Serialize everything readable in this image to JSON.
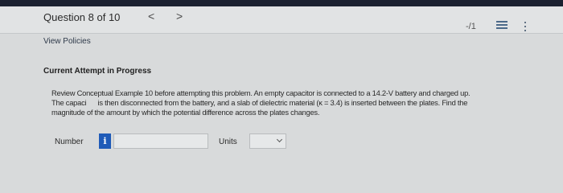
{
  "header": {
    "question_title": "Question 8 of 10",
    "prev_glyph": "<",
    "next_glyph": ">",
    "score": "-/1",
    "list_icon": "list-icon",
    "more_icon": "more-vertical-icon"
  },
  "links": {
    "view_policies": "View Policies"
  },
  "attempt": {
    "status": "Current Attempt in Progress"
  },
  "question": {
    "text_line1": "Review Conceptual Example 10 before attempting this problem. An empty capacitor is connected to a 14.2-V battery and charged up.",
    "text_line2": "The capaci      is then disconnected from the battery, and a slab of dielectric material (κ = 3.4) is inserted between the plates. Find the",
    "text_line3": "magnitude of the amount by which the potential difference across the plates changes."
  },
  "answer": {
    "number_label": "Number",
    "info_glyph": "i",
    "number_value": "",
    "units_label": "Units",
    "units_selected": ""
  },
  "colors": {
    "top_bar": "#1b2130",
    "info_badge": "#1f5bb8",
    "page_background": "#d8dadb"
  }
}
